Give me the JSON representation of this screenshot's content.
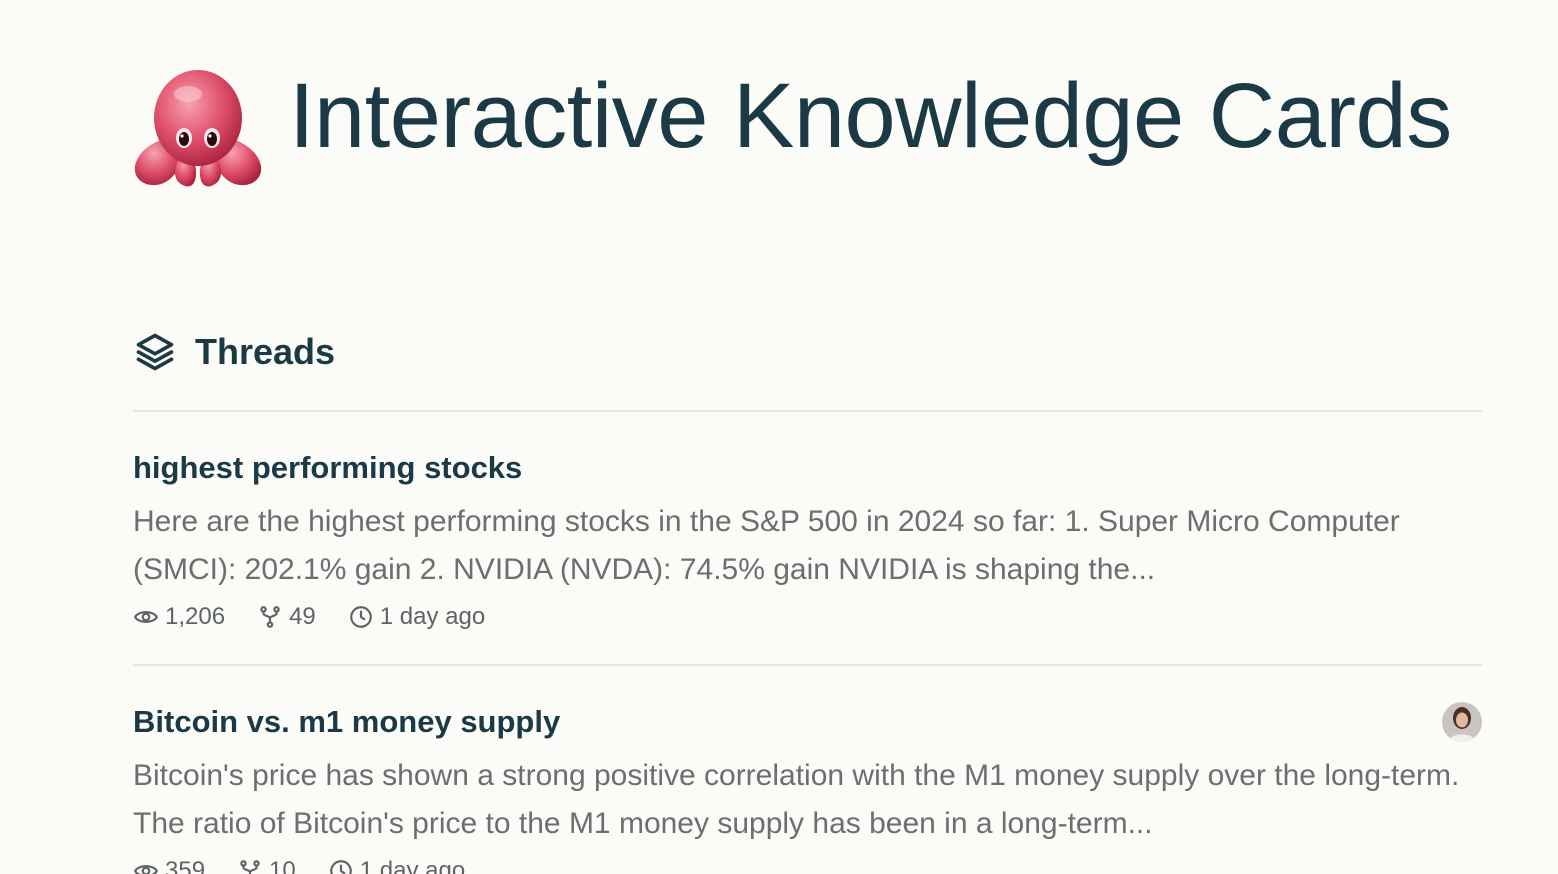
{
  "header": {
    "logo_icon": "octopus-icon",
    "title": "Interactive Knowledge Cards"
  },
  "section": {
    "icon": "layers-icon",
    "title": "Threads"
  },
  "threads": [
    {
      "title": "highest performing stocks",
      "snippet": "Here are the highest performing stocks in the S&P 500 in 2024 so far: 1. Super Micro Computer (SMCI): 202.1% gain 2. NVIDIA (NVDA): 74.5% gain NVIDIA is shaping the...",
      "views": "1,206",
      "forks": "49",
      "time": "1 day ago",
      "has_avatar": false
    },
    {
      "title": "Bitcoin vs. m1 money supply",
      "snippet": "Bitcoin's price has shown a strong positive correlation with the M1 money supply over the long-term. The ratio of Bitcoin's price to the M1 money supply has been in a long-term...",
      "views": "359",
      "forks": "10",
      "time": "1 day ago",
      "has_avatar": true
    }
  ],
  "colors": {
    "background": "#fbfbf8",
    "heading": "#1b3a45",
    "body_text": "#6a6f70",
    "divider": "#e6e6e2",
    "octopus": "#e0506a"
  }
}
